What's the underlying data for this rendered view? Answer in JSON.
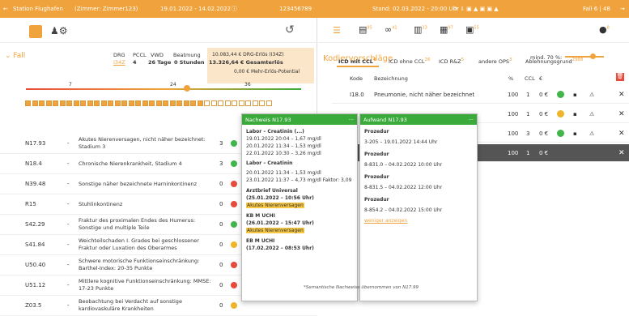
{
  "topbar": {
    "station": "Station Flughafen",
    "room": "(Zimmer: Zimmer123)",
    "dates": "19.01.2022 - 14.02.2022",
    "case_id": "123456789",
    "stand": "Stand: 02.03.2022 - 20:00 Uhr",
    "fall": "Fall 6 | 48"
  },
  "left": {
    "section_title": "Fall",
    "labels": {
      "drg": "DRG",
      "pccl": "PCCL",
      "vwd": "VWD",
      "beatmung": "Beatmung"
    },
    "values": {
      "drg": "I34Z",
      "pccl": "4",
      "vwd": "26 Tage",
      "beatmung": "0 Stunden"
    },
    "revenue": {
      "drg_erloes": "10.083,44 € DRG-Erlös (I34Z)",
      "gesamt": "13.326,64 € Gesamterlös",
      "mehr": "0,00 € Mehr-Erlös-Potential"
    },
    "scale": {
      "a": "7",
      "b": "24",
      "c": "36"
    },
    "rows": [
      {
        "code": "N17.93",
        "dash": "-",
        "desc": "Akutes Nierenversagen, nicht näher bezeichnet: Stadium 3",
        "num": "3",
        "status": "green"
      },
      {
        "code": "N18.4",
        "dash": "-",
        "desc": "Chronische Nierenkrankheit, Stadium 4",
        "num": "3",
        "status": "green"
      },
      {
        "code": "N39.48",
        "dash": "-",
        "desc": "Sonstige näher bezeichnete Harninkontinenz",
        "num": "0",
        "status": "red"
      },
      {
        "code": "R15",
        "dash": "-",
        "desc": "Stuhlinkontinenz",
        "num": "0",
        "status": "red"
      },
      {
        "code": "S42.29",
        "dash": "-",
        "desc": "Fraktur des proximalen Endes des Humerus: Sonstige und multiple Teile",
        "num": "0",
        "status": "green"
      },
      {
        "code": "S41.84",
        "dash": "-",
        "desc": "Weichteilschaden I. Grades bei geschlossener Fraktur oder Luxation des Oberarmes",
        "num": "0",
        "status": "yellow"
      },
      {
        "code": "U50.40",
        "dash": "-",
        "desc": "Schwere motorische Funktionseinschränkung: Barthel-Index: 20-35 Punkte",
        "num": "0",
        "status": "red"
      },
      {
        "code": "U51.12",
        "dash": "-",
        "desc": "Mittlere kognitive Funktionseinschränkung: MMSE: 17-23 Punkte",
        "num": "0",
        "status": "red"
      },
      {
        "code": "Z03.5",
        "dash": "-",
        "desc": "Beobachtung bei Verdacht auf sonstige kardiovaskuläre Krankheiten",
        "num": "0",
        "status": "yellow"
      }
    ]
  },
  "popup1": {
    "title": "Nachweis N17.93",
    "lab1": "Labor – Creatinin (...)",
    "lab1_l1": "19.01.2022 20:04 – 1,67 mg/dl",
    "lab1_l2": "20.01.2022 11:34 – 1,53 mg/dl",
    "lab1_l3": "22.01.2022 10:30 – 3,26 mg/dl",
    "lab2": "Labor – Creatinin",
    "lab2_l1": "20.01.2022 11:34 – 1,53 mg/dl",
    "lab2_l2": "23.01.2022 11:37 – 4,73 mg/dl Faktor: 3,09",
    "doc1": "Arztbrief Universal",
    "doc1_date": "(25.01.2022 – 10:56 Uhr)",
    "hl1": "Akutes Nierenversagen",
    "doc2": "KB M UCHI",
    "doc2_date": "(26.01.2022 – 15:47 Uhr)",
    "hl2": "Akutes Nierenversagen",
    "doc3": "EB M UCHI",
    "doc3_date": "(17.02.2022 – 08:53 Uhr)"
  },
  "popup2": {
    "title": "Aufwand N17.93",
    "p1": "Prozedur",
    "p1_v": "3-205 – 19.01.2022 14:44 Uhr",
    "p2": "Prozedur",
    "p2_v": "8-831.0 – 04.02.2022 10:00 Uhr",
    "p3": "Prozedur",
    "p3_v": "8-831.5 – 04.02.2022 12:00 Uhr",
    "p4": "Prozedur",
    "p4_v": "8-854.2 – 04.02.2022 15:00 Uhr",
    "more": "weniger anzeigen"
  },
  "footnote": "*Semantische Nachweise übernommen von N17.99",
  "right": {
    "title": "Kodiervorschläge",
    "mind": "mind. 70 %:",
    "toolbar_badges": [
      "95",
      "41",
      "33",
      "97",
      "55"
    ],
    "chat_badge": "8",
    "tabs": [
      {
        "label": "ICD mit CCL",
        "count": "4"
      },
      {
        "label": "ICD ohne CCL",
        "count": "26"
      },
      {
        "label": "ICD R&Z",
        "count": "5"
      },
      {
        "label": "andere OPS",
        "count": "3"
      },
      {
        "label": "Ablehnungsgrund",
        "count": "2988"
      }
    ],
    "cols": {
      "kode": "Kode",
      "bez": "Bezeichnung",
      "pct": "%",
      "ccl": "CCL",
      "eur": "€"
    },
    "rows": [
      {
        "kode": "I18.0",
        "bez": "Pneumonie, nicht näher bezeichnet",
        "pct": "100",
        "ccl": "1",
        "eur": "0 €"
      },
      {
        "kode": "",
        "bez": "",
        "pct": "100",
        "ccl": "1",
        "eur": "0 €"
      },
      {
        "kode": "",
        "bez": "",
        "pct": "100",
        "ccl": "3",
        "eur": "0 €"
      },
      {
        "kode": "",
        "bez": "",
        "pct": "100",
        "ccl": "1",
        "eur": "0 €"
      }
    ]
  },
  "colors": {
    "orange": "#f0a33c",
    "green": "#3aaa3a",
    "red": "#e84a3c"
  }
}
